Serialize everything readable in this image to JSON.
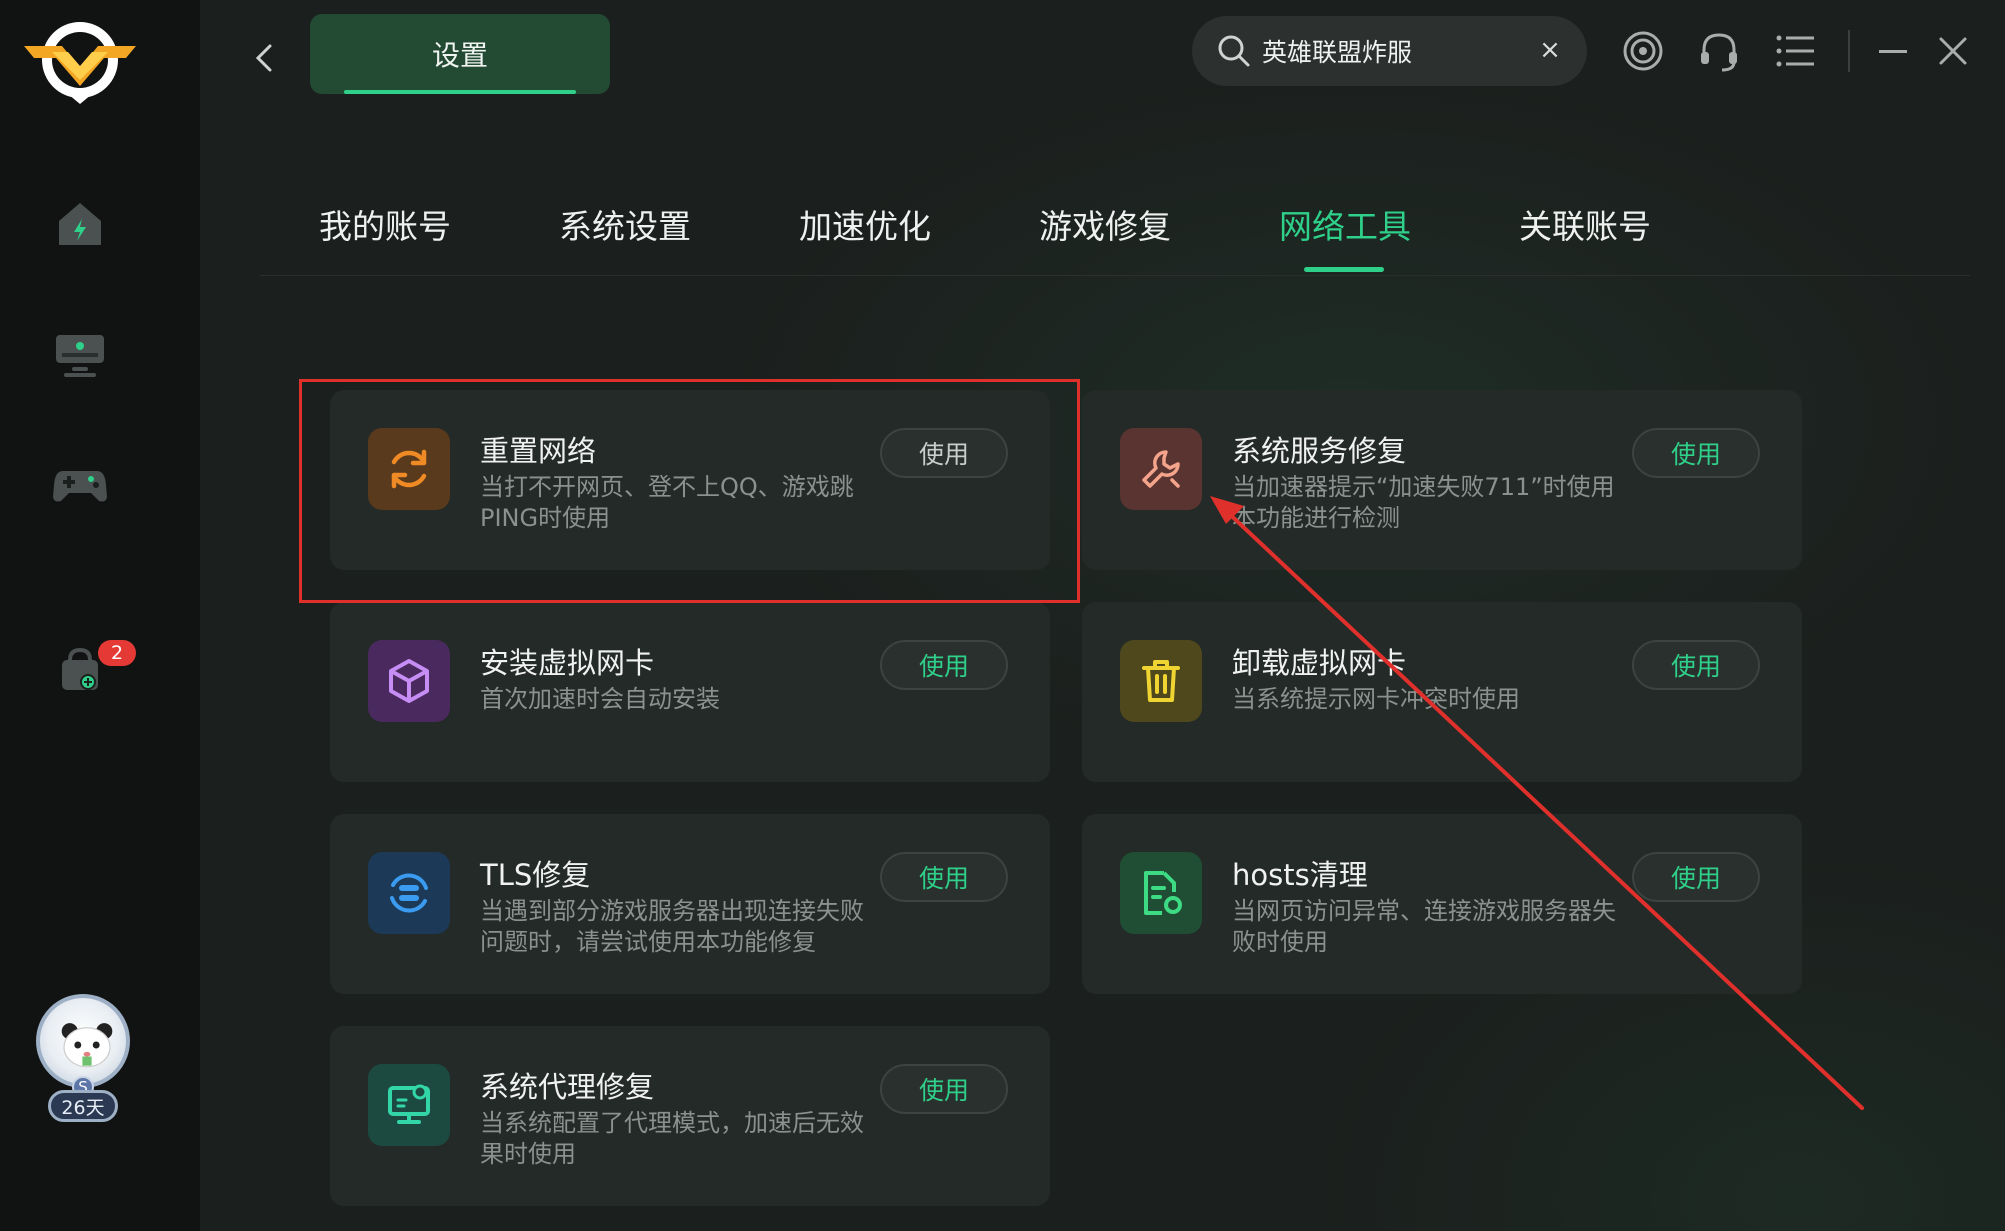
{
  "header": {
    "title": "设置",
    "search_value": "英雄联盟炸服",
    "clear_label": "×"
  },
  "sidebar": {
    "badge_count": "2",
    "avatar_level": "S",
    "avatar_days": "26天",
    "items": [
      {
        "icon": "home-lightning-icon"
      },
      {
        "icon": "monitor-icon"
      },
      {
        "icon": "gamepad-icon"
      },
      {
        "icon": "bag-plus-icon"
      }
    ]
  },
  "top_icons": [
    "target-icon",
    "headset-icon",
    "menu-list-icon",
    "minimize-icon",
    "close-icon"
  ],
  "tabs": [
    {
      "label": "我的账号"
    },
    {
      "label": "系统设置"
    },
    {
      "label": "加速优化"
    },
    {
      "label": "游戏修复"
    },
    {
      "label": "网络工具",
      "active": true
    },
    {
      "label": "关联账号"
    }
  ],
  "tools": [
    {
      "title": "重置网络",
      "desc": "当打不开网页、登不上QQ、游戏跳PING时使用",
      "button": "使用",
      "icon": "refresh-icon",
      "color": "#f08a24",
      "bg": "#5a3a1c"
    },
    {
      "title": "系统服务修复",
      "desc": "当加速器提示“加速失败711”时使用本功能进行检测",
      "button": "使用",
      "icon": "wrench-icon",
      "color": "#f4a48a",
      "bg": "#5a3430"
    },
    {
      "title": "安装虚拟网卡",
      "desc": "首次加速时会自动安装",
      "button": "使用",
      "icon": "cube-icon",
      "color": "#c68df5",
      "bg": "#4a2a5e"
    },
    {
      "title": "卸载虚拟网卡",
      "desc": "当系统提示网卡冲突时使用",
      "button": "使用",
      "icon": "trash-icon",
      "color": "#f0d431",
      "bg": "#4e481c"
    },
    {
      "title": "TLS修复",
      "desc": "当遇到部分游戏服务器出现连接失败问题时，请尝试使用本功能修复",
      "button": "使用",
      "icon": "server-sync-icon",
      "color": "#3a9bf0",
      "bg": "#1c3a58"
    },
    {
      "title": "hosts清理",
      "desc": "当网页访问异常、连接游戏服务器失败时使用",
      "button": "使用",
      "icon": "file-clean-icon",
      "color": "#3ddc84",
      "bg": "#1f4e34"
    },
    {
      "title": "系统代理修复",
      "desc": "当系统配置了代理模式，加速后无效果时使用",
      "button": "使用",
      "icon": "monitor-fix-icon",
      "color": "#33d6a6",
      "bg": "#1c4a40"
    }
  ],
  "colors": {
    "accent": "#2ed08a",
    "highlight": "#e0302c"
  }
}
